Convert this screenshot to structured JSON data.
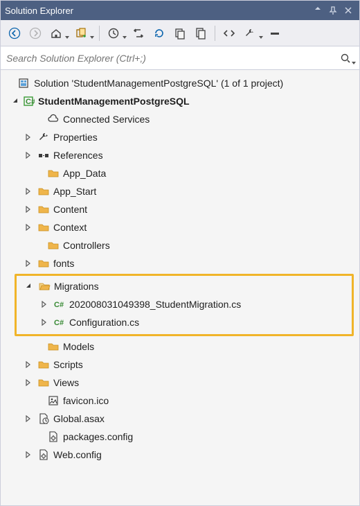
{
  "panel": {
    "title": "Solution Explorer"
  },
  "search": {
    "placeholder": "Search Solution Explorer (Ctrl+;)"
  },
  "solution": {
    "label": "Solution 'StudentManagementPostgreSQL' (1 of 1 project)",
    "project": "StudentManagementPostgreSQL",
    "nodes": {
      "connected": "Connected Services",
      "properties": "Properties",
      "references": "References",
      "appdata": "App_Data",
      "appstart": "App_Start",
      "content": "Content",
      "context": "Context",
      "controllers": "Controllers",
      "fonts": "fonts",
      "migrations": "Migrations",
      "mig_file": "202008031049398_StudentMigration.cs",
      "config_file": "Configuration.cs",
      "models": "Models",
      "scripts": "Scripts",
      "views": "Views",
      "favicon": "favicon.ico",
      "global": "Global.asax",
      "packages": "packages.config",
      "webconfig": "Web.config"
    }
  }
}
